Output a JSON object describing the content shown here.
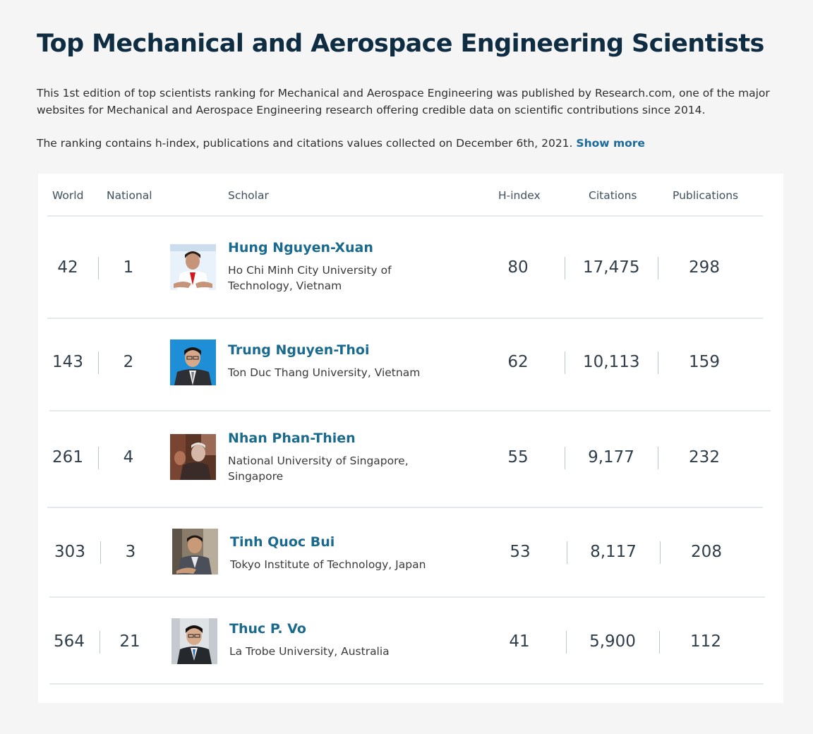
{
  "page": {
    "title": "Top Mechanical and Aerospace Engineering Scientists",
    "intro_p1": "This 1st edition of top scientists ranking for Mechanical and Aerospace Engineering was published by Research.com, one of the major websites for Mechanical and Aerospace Engineering research offering credible data on scientific contributions since 2014.",
    "intro_p2": "The ranking contains h-index, publications and citations values collected on December 6th, 2021.",
    "show_more": "Show more"
  },
  "table": {
    "headers": {
      "world": "World",
      "national": "National",
      "scholar": "Scholar",
      "hindex": "H-index",
      "citations": "Citations",
      "publications": "Publications"
    },
    "rows": [
      {
        "world": "42",
        "national": "1",
        "name": "Hung Nguyen-Xuan",
        "affiliation": "Ho Chi Minh City University of Technology, Vietnam",
        "hindex": "80",
        "citations": "17,475",
        "publications": "298"
      },
      {
        "world": "143",
        "national": "2",
        "name": "Trung Nguyen-Thoi",
        "affiliation": "Ton Duc Thang University, Vietnam",
        "hindex": "62",
        "citations": "10,113",
        "publications": "159"
      },
      {
        "world": "261",
        "national": "4",
        "name": "Nhan Phan-Thien",
        "affiliation": "National University of Singapore, Singapore",
        "hindex": "55",
        "citations": "9,177",
        "publications": "232"
      },
      {
        "world": "303",
        "national": "3",
        "name": "Tinh Quoc Bui",
        "affiliation": "Tokyo Institute of Technology, Japan",
        "hindex": "53",
        "citations": "8,117",
        "publications": "208"
      },
      {
        "world": "564",
        "national": "21",
        "name": "Thuc P. Vo",
        "affiliation": "La Trobe University, Australia",
        "hindex": "41",
        "citations": "5,900",
        "publications": "112"
      }
    ]
  }
}
